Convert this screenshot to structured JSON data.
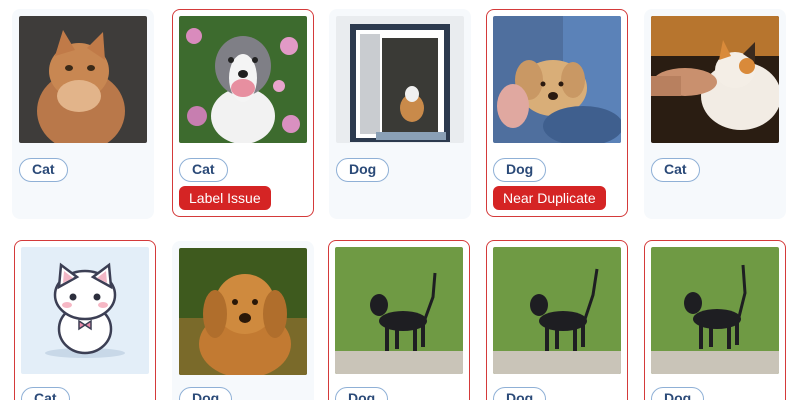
{
  "colors": {
    "flag_border": "#d43a3a",
    "issue_bg": "#d52424",
    "chip_text": "#2b4a78",
    "chip_border": "#8fb0d6"
  },
  "cards": [
    {
      "image": "orange-longhair-cat",
      "label": "Cat",
      "issue": ""
    },
    {
      "image": "pitbull-dog-flowers",
      "label": "Cat",
      "issue": "Label Issue"
    },
    {
      "image": "dog-in-window",
      "label": "Dog",
      "issue": ""
    },
    {
      "image": "golden-puppy-held",
      "label": "Dog",
      "issue": "Near Duplicate"
    },
    {
      "image": "calico-cat-petted",
      "label": "Cat",
      "issue": ""
    },
    {
      "image": "cartoon-cat",
      "label": "Cat",
      "issue": ""
    },
    {
      "image": "golden-retriever-puppy",
      "label": "Dog",
      "issue": ""
    },
    {
      "image": "dachshund-grass",
      "label": "Dog",
      "issue": ""
    },
    {
      "image": "dachshund-grass",
      "label": "Dog",
      "issue": ""
    },
    {
      "image": "dachshund-grass",
      "label": "Dog",
      "issue": ""
    }
  ]
}
